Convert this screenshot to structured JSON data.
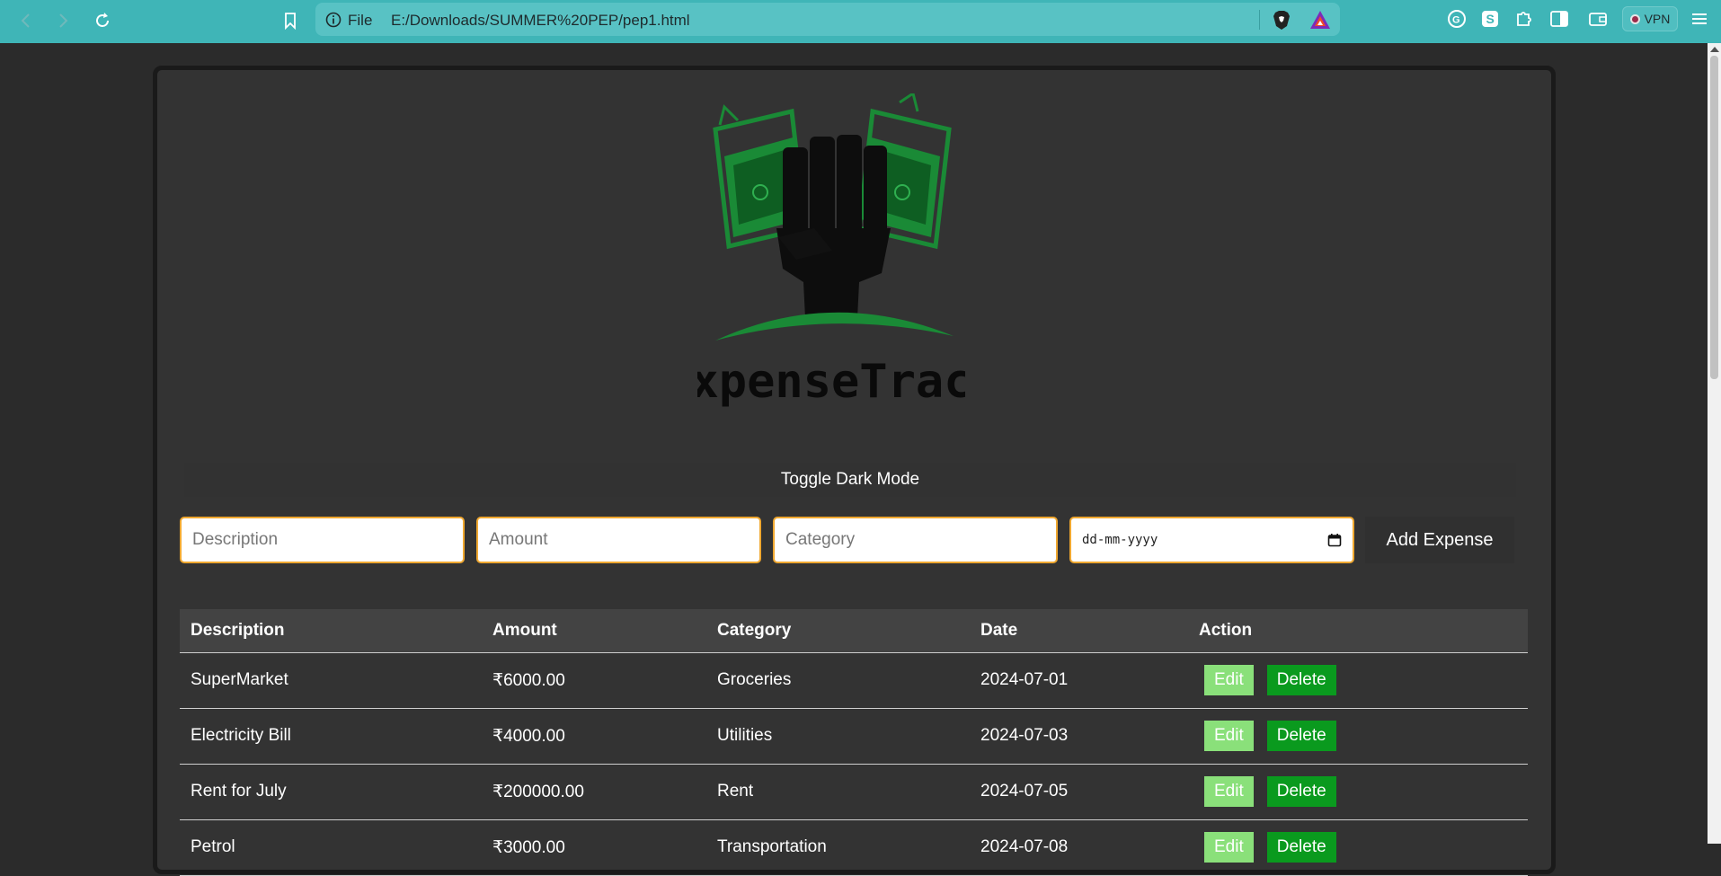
{
  "browser": {
    "url_scheme_label": "File",
    "url": "E:/Downloads/SUMMER%20PEP/pep1.html",
    "vpn_label": "VPN",
    "colors": {
      "toolbar": "#3fb5b7",
      "urlbar": "#58c2c4"
    }
  },
  "logo": {
    "text": "ExpenseTrack"
  },
  "toggle": {
    "label": "Toggle Dark Mode"
  },
  "form": {
    "description_placeholder": "Description",
    "amount_placeholder": "Amount",
    "category_placeholder": "Category",
    "date_placeholder": "dd-mm-yyyy",
    "add_label": "Add Expense"
  },
  "table": {
    "headers": [
      "Description",
      "Amount",
      "Category",
      "Date",
      "Action"
    ],
    "rows": [
      {
        "description": "SuperMarket",
        "amount": "₹6000.00",
        "category": "Groceries",
        "date": "2024-07-01"
      },
      {
        "description": "Electricity Bill",
        "amount": "₹4000.00",
        "category": "Utilities",
        "date": "2024-07-03"
      },
      {
        "description": "Rent for July",
        "amount": "₹200000.00",
        "category": "Rent",
        "date": "2024-07-05"
      },
      {
        "description": "Petrol",
        "amount": "₹3000.00",
        "category": "Transportation",
        "date": "2024-07-08"
      }
    ],
    "edit_label": "Edit",
    "delete_label": "Delete"
  },
  "colors": {
    "edit_button": "#8ae07a",
    "delete_button": "#0a9a1e",
    "input_border": "#f0a830",
    "logo_green": "#1a8a36"
  }
}
